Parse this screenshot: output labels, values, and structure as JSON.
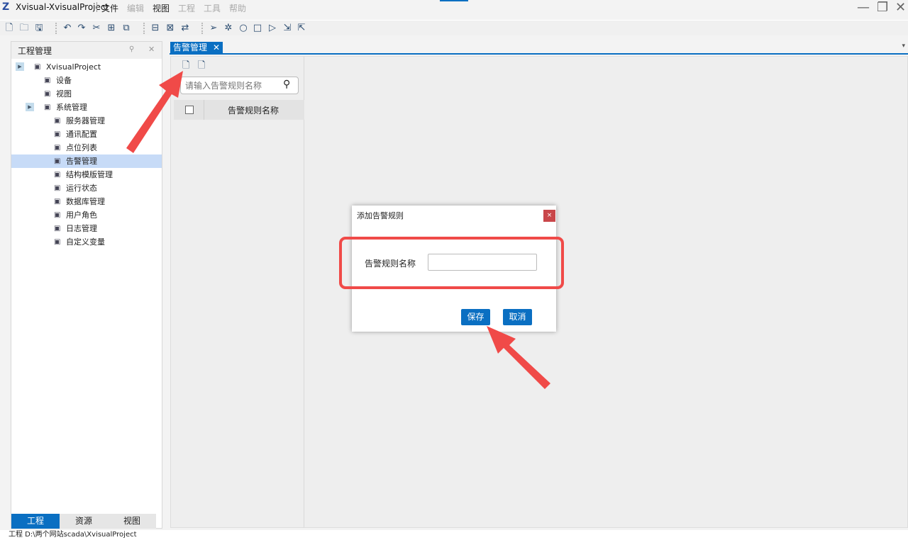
{
  "window": {
    "title": "Xvisual-XvisualProject",
    "menus": [
      "文件",
      "编辑",
      "视图",
      "工程",
      "工具",
      "帮助"
    ]
  },
  "left_panel": {
    "title": "工程管理",
    "tree": [
      {
        "label": "XvisualProject",
        "icon": "layers-icon",
        "level": 0,
        "expander": true
      },
      {
        "label": "设备",
        "icon": "device-icon",
        "level": 1
      },
      {
        "label": "视图",
        "icon": "view-icon",
        "level": 1
      },
      {
        "label": "系统管理",
        "icon": "globe-icon",
        "level": 1,
        "expander": true
      },
      {
        "label": "服务器管理",
        "icon": "server-icon",
        "level": 2
      },
      {
        "label": "通讯配置",
        "icon": "link-icon",
        "level": 2
      },
      {
        "label": "点位列表",
        "icon": "pin-icon",
        "level": 2
      },
      {
        "label": "告警管理",
        "icon": "alarm-icon",
        "level": 2,
        "selected": true
      },
      {
        "label": "结构模版管理",
        "icon": "structure-icon",
        "level": 2
      },
      {
        "label": "运行状态",
        "icon": "status-icon",
        "level": 2
      },
      {
        "label": "数据库管理",
        "icon": "database-icon",
        "level": 2
      },
      {
        "label": "用户角色",
        "icon": "user-icon",
        "level": 2
      },
      {
        "label": "日志管理",
        "icon": "log-icon",
        "level": 2
      },
      {
        "label": "自定义变量",
        "icon": "variable-icon",
        "level": 2
      }
    ],
    "bottom_tabs": [
      "工程",
      "资源",
      "视图"
    ]
  },
  "main": {
    "tab": "告警管理",
    "search_placeholder": "请输入告警规则名称",
    "column": "告警规则名称"
  },
  "dialog": {
    "title": "添加告警规则",
    "close": "×",
    "field_label": "告警规则名称",
    "field_value": "",
    "save": "保存",
    "cancel": "取消"
  },
  "status": "工程 D:\\两个网站scada\\XvisualProject",
  "colors": {
    "accent": "#0a6fc2",
    "highlight": "#f04a48",
    "close": "#c9474a"
  }
}
